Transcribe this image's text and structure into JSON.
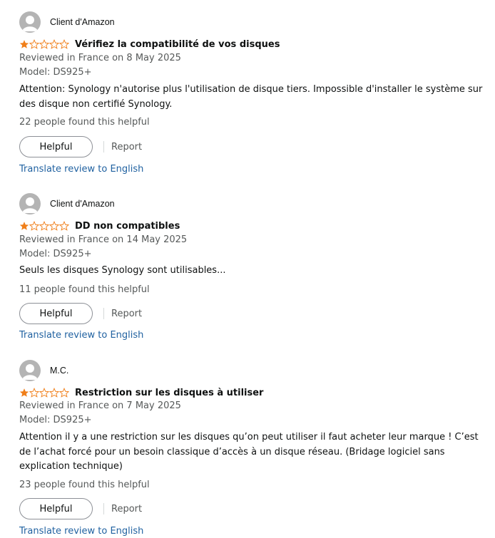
{
  "reviews": [
    {
      "author": "Client d'Amazon",
      "rating": 1,
      "title": "Vérifiez la compatibilité de vos disques",
      "meta": "Reviewed in France on 8 May 2025",
      "model": "Model: DS925+",
      "body": "Attention: Synology n'autorise plus l'utilisation de disque tiers. Impossible d'installer le système sur des disque non certifié Synology.",
      "helpful_count": "22 people found this helpful",
      "helpful_label": "Helpful",
      "report_label": "Report",
      "translate_label": "Translate review to English"
    },
    {
      "author": "Client d'Amazon",
      "rating": 1,
      "title": "DD non compatibles",
      "meta": "Reviewed in France on 14 May 2025",
      "model": "Model: DS925+",
      "body": "Seuls les disques Synology sont utilisables...",
      "helpful_count": "11 people found this helpful",
      "helpful_label": "Helpful",
      "report_label": "Report",
      "translate_label": "Translate review to English"
    },
    {
      "author": "M.C.",
      "rating": 1,
      "title": "Restriction sur les disques à utiliser",
      "meta": "Reviewed in France on 7 May 2025",
      "model": "Model: DS925+",
      "body": "Attention il y a une restriction sur les disques qu’on peut utiliser il faut acheter leur marque ! C’est de l’achat forcé pour un besoin classique d’accès à un disque réseau. (Bridage logiciel sans explication technique)",
      "helpful_count": "23 people found this helpful",
      "helpful_label": "Helpful",
      "report_label": "Report",
      "translate_label": "Translate review to English"
    }
  ],
  "colors": {
    "star_filled": "#f07f1a",
    "star_empty": "#f07f1a",
    "link": "#2162a1",
    "avatar": "#b4b4b4"
  },
  "icons": {
    "avatar": "user-avatar-icon",
    "star": "star-icon"
  }
}
